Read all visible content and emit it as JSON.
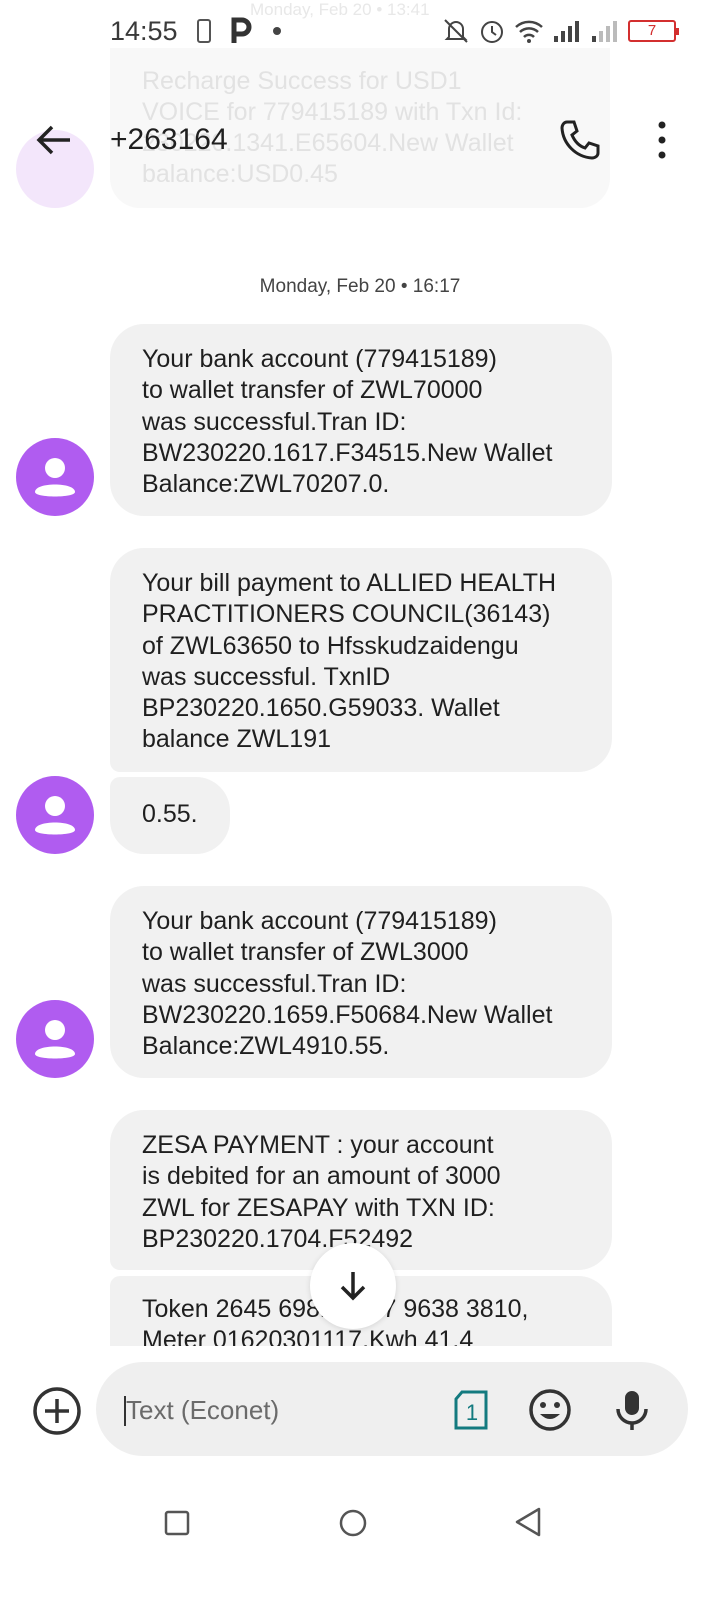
{
  "status_bar": {
    "time": "14:55",
    "battery": "7"
  },
  "background_residue": {
    "date_stamp": "Monday, Feb 20 • 13:41",
    "previous_message": "Recharge Success for USD1\nVOICE for 779415189 with Txn Id:\n230220.1341.E65604.New Wallet\nbalance:USD0.45"
  },
  "header": {
    "title": "+263164"
  },
  "date_separator": "Monday, Feb 20 • 16:17",
  "messages": [
    {
      "lines": "Your bank account (779415189)\nto wallet transfer of ZWL70000\nwas successful.Tran ID:\nBW230220.1617.F34515.New Wallet\nBalance:ZWL70207.0."
    },
    {
      "lines": "Your bill payment to ALLIED HEALTH\nPRACTITIONERS COUNCIL(36143)\nof ZWL63650 to Hfsskudzaidengu\nwas successful. TxnID\nBP230220.1650.G59033. Wallet\nbalance ZWL191"
    },
    {
      "lines": "0.55."
    },
    {
      "lines": "Your bank account (779415189)\nto wallet transfer of ZWL3000\nwas successful.Tran ID:\nBW230220.1659.F50684.New Wallet\nBalance:ZWL4910.55."
    },
    {
      "lines": "ZESA PAYMENT : your account\nis debited for an amount of 3000\nZWL for ZESAPAY with TXN ID:\nBP230220.1704.F52492"
    },
    {
      "lines": "Token 2645 6981 4197 9638 3810,\nMeter 01620301117,Kwh 41.4"
    }
  ],
  "composer": {
    "placeholder": "Text (Econet)",
    "sim_number": "1"
  },
  "colors": {
    "avatar": "#b05cf0",
    "bubble": "#f1f1f1",
    "sim_icon": "#137a7f"
  },
  "icons": {
    "back": "arrow-left",
    "call": "phone",
    "more": "vertical-dots",
    "scroll": "arrow-down",
    "add": "plus-circle",
    "emoji": "smiley",
    "mic": "microphone"
  }
}
